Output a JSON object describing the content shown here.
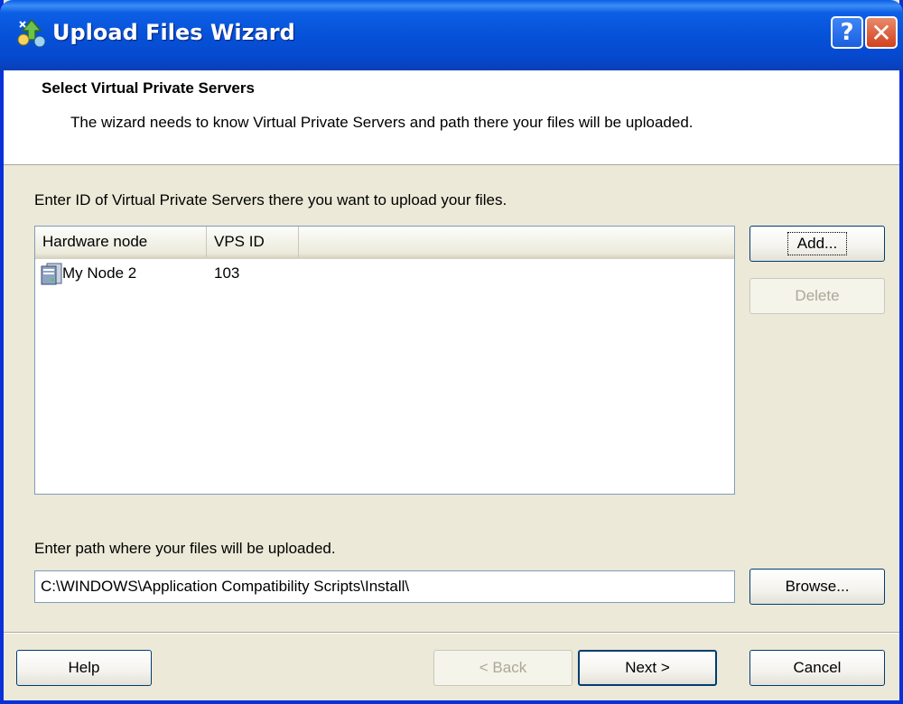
{
  "window": {
    "title": "Upload Files Wizard",
    "title_icon": "wizard-upload-icon",
    "help_icon": "?",
    "close_icon": "✕"
  },
  "header": {
    "title": "Select Virtual Private Servers",
    "subtitle": "The wizard needs to know Virtual Private Servers  and path there your files will be uploaded."
  },
  "servers": {
    "prompt": "Enter ID of Virtual Private Servers there you want to upload your files.",
    "columns": [
      "Hardware node",
      "VPS ID"
    ],
    "rows": [
      {
        "node": "My Node 2",
        "vps_id": "103",
        "icon": "server-node-icon"
      }
    ],
    "add_label": "Add...",
    "delete_label": "Delete"
  },
  "path": {
    "prompt": "Enter path where your files will be uploaded.",
    "value": "C:\\WINDOWS\\Application Compatibility Scripts\\Install\\",
    "browse_label": "Browse..."
  },
  "footer": {
    "help_label": "Help",
    "back_label": "< Back",
    "next_label": "Next >",
    "cancel_label": "Cancel"
  },
  "colors": {
    "titlebar": "#0652d8",
    "dialog_bg": "#ece9d8",
    "close_button": "#d2401d"
  }
}
